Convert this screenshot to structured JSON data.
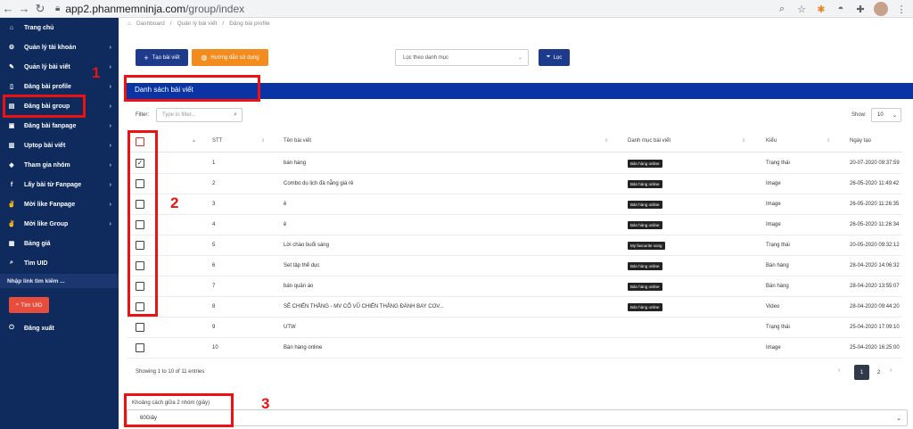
{
  "browser": {
    "url_host": "app2.phanmemninja.com",
    "url_path": "/group/index"
  },
  "sidebar": {
    "items": [
      {
        "label": "Trang chủ",
        "icon": "home-icon",
        "glyph": "⌂",
        "chev": false
      },
      {
        "label": "Quản lý tài khoản",
        "icon": "gear-icon",
        "glyph": "⚙",
        "chev": true
      },
      {
        "label": "Quản lý bài viết",
        "icon": "pencil-icon",
        "glyph": "✎",
        "chev": true
      },
      {
        "label": "Đăng bài profile",
        "icon": "file-icon",
        "glyph": "▯",
        "chev": true
      },
      {
        "label": "Đăng bài group",
        "icon": "edit-icon",
        "glyph": "▤",
        "chev": true
      },
      {
        "label": "Đăng bài fanpage",
        "icon": "copy-icon",
        "glyph": "▣",
        "chev": true
      },
      {
        "label": "Uptop bài viết",
        "icon": "doc-icon",
        "glyph": "▥",
        "chev": true
      },
      {
        "label": "Tham gia nhóm",
        "icon": "users-icon",
        "glyph": "◈",
        "chev": true
      },
      {
        "label": "Lấy bài từ Fanpage",
        "icon": "facebook-icon",
        "glyph": "f",
        "chev": true
      },
      {
        "label": "Mời like Fanpage",
        "icon": "thumbs-up-icon",
        "glyph": "✌",
        "chev": true
      },
      {
        "label": "Mời like Group",
        "icon": "thumbs-up-icon",
        "glyph": "✌",
        "chev": true
      },
      {
        "label": "Bảng giá",
        "icon": "table-icon",
        "glyph": "▦",
        "chev": false
      },
      {
        "label": "Tìm UID",
        "icon": "search-icon",
        "glyph": "⌕",
        "chev": false
      }
    ],
    "search_link_label": "Nhập link tìm kiếm ...",
    "find_uid_button": "Tìm UID",
    "logout_label": "Đăng xuất"
  },
  "breadcrumb": [
    "Dashboard",
    "Quản lý bài viết",
    "Đăng bài profile"
  ],
  "toolbar": {
    "new_post": "Tạo bài viết",
    "guide": "Hướng dẫn sử dụng",
    "category_placeholder": "Lọc theo danh mục",
    "filter_button": "Lọc"
  },
  "panel": {
    "title": "Danh sách bài viết",
    "filter_label": "Filter:",
    "filter_placeholder": "Type to filter...",
    "show_label": "Show:",
    "show_value": "10"
  },
  "table": {
    "headers": [
      "STT",
      "Tên bài viết",
      "Danh mục bài viết",
      "Kiểu",
      "Ngày tạo"
    ],
    "rows": [
      {
        "checked": true,
        "stt": "1",
        "name": "bán hàng",
        "category": "Bán hàng online",
        "type": "Trạng thái",
        "date": "20-07-2020 09:37:59"
      },
      {
        "checked": false,
        "stt": "2",
        "name": "Combo du lịch đà nẵng giá rẻ",
        "category": "Bán hàng online",
        "type": "Image",
        "date": "26-05-2020 11:49:42"
      },
      {
        "checked": false,
        "stt": "3",
        "name": "ê",
        "category": "Bán hàng online",
        "type": "Image",
        "date": "26-05-2020 11:26:35"
      },
      {
        "checked": false,
        "stt": "4",
        "name": "ê",
        "category": "Bán hàng online",
        "type": "Image",
        "date": "26-05-2020 11:26:34"
      },
      {
        "checked": false,
        "stt": "5",
        "name": "Lời chào buổi sáng",
        "category": "My favourite song",
        "type": "Trạng thái",
        "date": "20-05-2020 09:32:12"
      },
      {
        "checked": false,
        "stt": "6",
        "name": "Set tập thể dục",
        "category": "Bán hàng online",
        "type": "Bán hàng",
        "date": "28-04-2020 14:06:32"
      },
      {
        "checked": false,
        "stt": "7",
        "name": "bán quần áo",
        "category": "Bán hàng online",
        "type": "Bán hàng",
        "date": "28-04-2020 13:55:07"
      },
      {
        "checked": false,
        "stt": "8",
        "name": "SẼ CHIẾN THẮNG - MV CỔ VŨ CHIẾN THẮNG ĐÁNH BAY COV...",
        "category": "Bán hàng online",
        "type": "Video",
        "date": "28-04-2020 09:44:20"
      },
      {
        "checked": false,
        "stt": "9",
        "name": "UTW",
        "category": "",
        "type": "Trạng thái",
        "date": "25-04-2020 17:09:10"
      },
      {
        "checked": false,
        "stt": "10",
        "name": "Bán hàng online",
        "category": "",
        "type": "Image",
        "date": "25-04-2020 16:25:00"
      }
    ]
  },
  "pagination": {
    "info": "Showing 1 to 10 of 11 entries",
    "prev": "‹",
    "current": "1",
    "page2": "2",
    "next": "›"
  },
  "gap_setting": {
    "label": "Khoảng cách giữa 2 nhóm (giây)",
    "value": "60Giây"
  },
  "annotations": [
    "1",
    "2",
    "3"
  ],
  "colors": {
    "sidebar": "#0f2a5c",
    "title_bar": "#0a34a4",
    "primary": "#1e3a8a",
    "orange": "#f28c1f",
    "annotation": "#e11111",
    "find_uid": "#e74c3c"
  }
}
